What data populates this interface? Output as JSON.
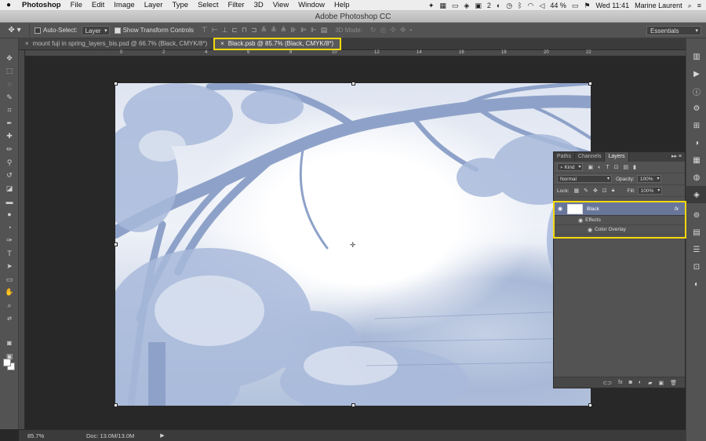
{
  "menubar": {
    "app": "Photoshop",
    "items": [
      "File",
      "Edit",
      "Image",
      "Layer",
      "Type",
      "Select",
      "Filter",
      "3D",
      "View",
      "Window",
      "Help"
    ],
    "battery": "44 %",
    "clock": "Wed 11:41",
    "user": "Marine Laurent",
    "badge": "2"
  },
  "window": {
    "title": "Adobe Photoshop CC"
  },
  "options": {
    "auto_select_label": "Auto-Select:",
    "auto_select_value": "Layer",
    "show_transform_label": "Show Transform Controls",
    "mode3d_label": "3D Mode:",
    "workspace": "Essentials"
  },
  "tabs": [
    {
      "label": "mount fuji in spring_layers_bis.psd @ 66.7% (Black, CMYK/8*)",
      "active": false
    },
    {
      "label": "Black.psb @ 85.7% (Black, CMYK/8*)",
      "active": true
    }
  ],
  "ruler": {
    "h_ticks": [
      "0",
      "2",
      "4",
      "6",
      "8",
      "10",
      "12",
      "14",
      "16",
      "18",
      "20",
      "22"
    ]
  },
  "status": {
    "zoom": "85.7%",
    "doc": "Doc: 13.0M/13.0M"
  },
  "layers_panel": {
    "tabs": [
      "Paths",
      "Channels",
      "Layers"
    ],
    "active_tab": "Layers",
    "filter_label": "Kind",
    "blend_mode": "Normal",
    "opacity_label": "Opacity:",
    "opacity": "100%",
    "lock_label": "Lock:",
    "fill_label": "Fill:",
    "fill": "100%",
    "layer": {
      "name": "Black",
      "fx": "fx"
    },
    "effects_label": "Effects",
    "effect_item": "Color Overlay"
  },
  "colors": {
    "highlight": "#f5d80b",
    "selected_layer": "#68769a",
    "tint": "#8fa3c8"
  }
}
